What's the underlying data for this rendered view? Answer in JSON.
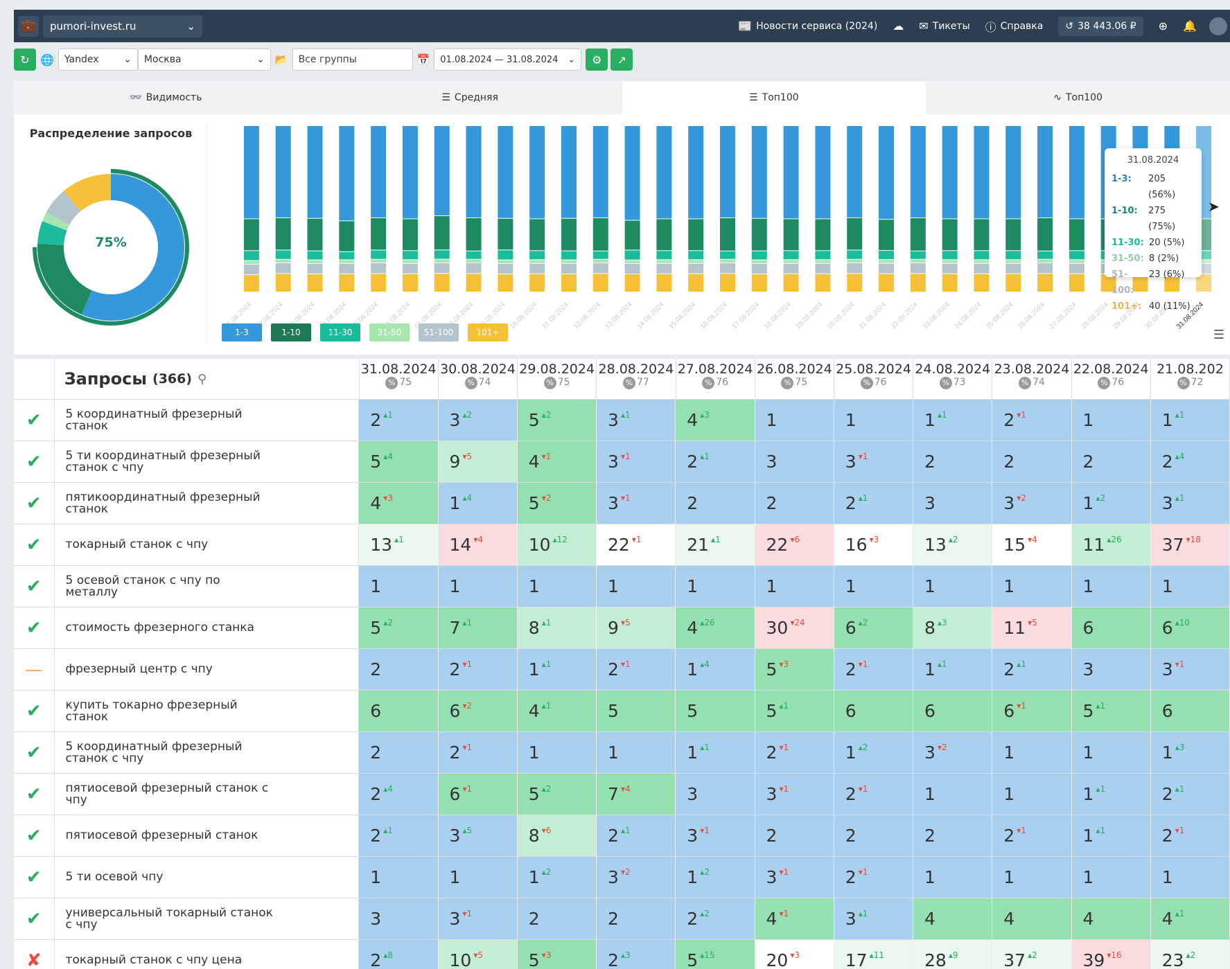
{
  "topbar": {
    "project": "pumori-invest.ru",
    "news": "Новости сервиса (2024)",
    "tickets": "Тикеты",
    "help": "Справка",
    "balance": "38 443.06 ₽"
  },
  "toolbar": {
    "engine": "Yandex",
    "region": "Москва",
    "groups_placeholder": "Все группы",
    "period": "01.08.2024 — 31.08.2024"
  },
  "tabs": [
    "Видимость",
    "Средняя",
    "Топ100",
    "Топ100"
  ],
  "chart": {
    "donut_title": "Распределение запросов",
    "donut_value": "75%",
    "legend": [
      "1-3",
      "1-10",
      "11-30",
      "31-50",
      "51-100",
      "101+"
    ],
    "colors": {
      "1-3": "#3498db",
      "1-10": "#1e8a60",
      "11-30": "#1abc9c",
      "31-50": "#a8e6b0",
      "51-100": "#b4c4cc",
      "101+": "#f7c137"
    },
    "tooltip": {
      "date": "31.08.2024",
      "rows": [
        {
          "label": "1-3:",
          "value": "205 (56%)",
          "color": "#2980b9"
        },
        {
          "label": "1-10:",
          "value": "275 (75%)",
          "color": "#1e8a60"
        },
        {
          "label": "11-30:",
          "value": "20 (5%)",
          "color": "#1abc9c"
        },
        {
          "label": "31-50:",
          "value": "8 (2%)",
          "color": "#8fd19e"
        },
        {
          "label": "51-100:",
          "value": "23 (6%)",
          "color": "#aab7bf"
        },
        {
          "label": "101+:",
          "value": "40 (11%)",
          "color": "#f0b14d"
        }
      ]
    }
  },
  "chart_data": {
    "type": "bar",
    "categories": [
      "01.08.2024",
      "02.08.2024",
      "03.08.2024",
      "04.08.2024",
      "05.08.2024",
      "06.08.2024",
      "07.08.2024",
      "08.08.2024",
      "09.08.2024",
      "10.08.2024",
      "11.08.2024",
      "12.08.2024",
      "13.08.2024",
      "14.08.2024",
      "15.08.2024",
      "16.08.2024",
      "17.08.2024",
      "18.08.2024",
      "19.08.2024",
      "20.08.2024",
      "21.08.2024",
      "22.08.2024",
      "23.08.2024",
      "24.08.2024",
      "25.08.2024",
      "26.08.2024",
      "27.08.2024",
      "28.08.2024",
      "29.08.2024",
      "30.08.2024",
      "31.08.2024"
    ],
    "stacked": true,
    "series": [
      {
        "name": "1-3",
        "values": [
          205,
          200,
          205,
          210,
          200,
          205,
          195,
          200,
          205,
          205,
          205,
          200,
          210,
          205,
          205,
          200,
          205,
          205,
          205,
          200,
          205,
          200,
          205,
          205,
          205,
          200,
          205,
          205,
          205,
          205,
          205
        ]
      },
      {
        "name": "1-10",
        "values": [
          70,
          70,
          72,
          68,
          70,
          70,
          74,
          72,
          70,
          70,
          72,
          72,
          66,
          70,
          70,
          72,
          72,
          70,
          70,
          70,
          68,
          72,
          70,
          70,
          70,
          72,
          70,
          70,
          70,
          70,
          70
        ]
      },
      {
        "name": "11-30",
        "values": [
          22,
          20,
          20,
          18,
          20,
          20,
          20,
          18,
          22,
          20,
          20,
          18,
          22,
          20,
          20,
          18,
          20,
          20,
          20,
          20,
          20,
          18,
          20,
          20,
          20,
          18,
          20,
          20,
          20,
          20,
          20
        ]
      },
      {
        "name": "31-50",
        "values": [
          8,
          8,
          8,
          8,
          8,
          8,
          8,
          8,
          8,
          8,
          8,
          8,
          8,
          8,
          8,
          8,
          8,
          8,
          8,
          8,
          8,
          8,
          8,
          8,
          8,
          8,
          8,
          8,
          8,
          8,
          8
        ]
      },
      {
        "name": "51-100",
        "values": [
          23,
          23,
          23,
          23,
          23,
          23,
          23,
          23,
          23,
          23,
          23,
          23,
          23,
          23,
          23,
          23,
          23,
          23,
          23,
          23,
          23,
          23,
          23,
          23,
          23,
          23,
          23,
          23,
          23,
          23,
          23
        ]
      },
      {
        "name": "101+",
        "values": [
          38,
          40,
          40,
          40,
          40,
          40,
          40,
          40,
          40,
          40,
          40,
          40,
          40,
          40,
          40,
          40,
          40,
          40,
          40,
          40,
          40,
          40,
          40,
          40,
          40,
          40,
          40,
          40,
          40,
          40,
          40
        ]
      }
    ],
    "donut": [
      {
        "name": "1-3",
        "value": 56
      },
      {
        "name": "1-10",
        "value": 19
      },
      {
        "name": "11-30",
        "value": 5
      },
      {
        "name": "31-50",
        "value": 2
      },
      {
        "name": "51-100",
        "value": 6
      },
      {
        "name": "101+",
        "value": 11
      }
    ]
  },
  "table": {
    "title": "Запросы",
    "count": "(366)",
    "dates": [
      {
        "d": "31.08.2024",
        "p": "75"
      },
      {
        "d": "30.08.2024",
        "p": "74"
      },
      {
        "d": "29.08.2024",
        "p": "75"
      },
      {
        "d": "28.08.2024",
        "p": "77"
      },
      {
        "d": "27.08.2024",
        "p": "76"
      },
      {
        "d": "26.08.2024",
        "p": "75"
      },
      {
        "d": "25.08.2024",
        "p": "76"
      },
      {
        "d": "24.08.2024",
        "p": "73"
      },
      {
        "d": "23.08.2024",
        "p": "74"
      },
      {
        "d": "22.08.2024",
        "p": "76"
      },
      {
        "d": "21.08.202",
        "p": "72"
      }
    ],
    "rows": [
      {
        "status": "ok",
        "q": "5 координатный фрезерный станок",
        "cells": [
          [
            "2",
            "+1",
            "b"
          ],
          [
            "3",
            "+2",
            "b"
          ],
          [
            "5",
            "+2",
            "g"
          ],
          [
            "3",
            "+1",
            "b"
          ],
          [
            "4",
            "+3",
            "g"
          ],
          [
            "1",
            "",
            "b"
          ],
          [
            "1",
            "",
            "b"
          ],
          [
            "1",
            "+1",
            "b"
          ],
          [
            "2",
            "-1",
            "b"
          ],
          [
            "1",
            "",
            "b"
          ],
          [
            "1",
            "+1",
            "b"
          ]
        ]
      },
      {
        "status": "ok",
        "q": "5 ти координатный фрезерный станок с чпу",
        "cells": [
          [
            "5",
            "+4",
            "g"
          ],
          [
            "9",
            "-5",
            "lg"
          ],
          [
            "4",
            "-1",
            "g"
          ],
          [
            "3",
            "-1",
            "b"
          ],
          [
            "2",
            "+1",
            "b"
          ],
          [
            "3",
            "",
            "b"
          ],
          [
            "3",
            "-1",
            "b"
          ],
          [
            "2",
            "",
            "b"
          ],
          [
            "2",
            "",
            "b"
          ],
          [
            "2",
            "",
            "b"
          ],
          [
            "2",
            "+4",
            "b"
          ]
        ]
      },
      {
        "status": "ok",
        "q": "пятикоординатный фрезерный станок",
        "cells": [
          [
            "4",
            "-3",
            "g"
          ],
          [
            "1",
            "+4",
            "b"
          ],
          [
            "5",
            "-2",
            "g"
          ],
          [
            "3",
            "-1",
            "b"
          ],
          [
            "2",
            "",
            "b"
          ],
          [
            "2",
            "",
            "b"
          ],
          [
            "2",
            "+1",
            "b"
          ],
          [
            "3",
            "",
            "b"
          ],
          [
            "3",
            "-2",
            "b"
          ],
          [
            "1",
            "+2",
            "b"
          ],
          [
            "3",
            "+1",
            "b"
          ]
        ]
      },
      {
        "status": "ok",
        "q": "токарный станок с чпу",
        "cells": [
          [
            "13",
            "+1",
            "v"
          ],
          [
            "14",
            "-4",
            "p"
          ],
          [
            "10",
            "+12",
            "lg"
          ],
          [
            "22",
            "-1",
            "w"
          ],
          [
            "21",
            "+1",
            "v"
          ],
          [
            "22",
            "-6",
            "p"
          ],
          [
            "16",
            "-3",
            "w"
          ],
          [
            "13",
            "+2",
            "v"
          ],
          [
            "15",
            "-4",
            "w"
          ],
          [
            "11",
            "+26",
            "lg"
          ],
          [
            "37",
            "-18",
            "p"
          ]
        ]
      },
      {
        "status": "ok",
        "q": "5 осевой станок с чпу по металлу",
        "cells": [
          [
            "1",
            "",
            "b"
          ],
          [
            "1",
            "",
            "b"
          ],
          [
            "1",
            "",
            "b"
          ],
          [
            "1",
            "",
            "b"
          ],
          [
            "1",
            "",
            "b"
          ],
          [
            "1",
            "",
            "b"
          ],
          [
            "1",
            "",
            "b"
          ],
          [
            "1",
            "",
            "b"
          ],
          [
            "1",
            "",
            "b"
          ],
          [
            "1",
            "",
            "b"
          ],
          [
            "1",
            "",
            "b"
          ]
        ]
      },
      {
        "status": "ok",
        "q": "стоимость фрезерного станка",
        "cells": [
          [
            "5",
            "+2",
            "g"
          ],
          [
            "7",
            "+1",
            "g"
          ],
          [
            "8",
            "+1",
            "lg"
          ],
          [
            "9",
            "-5",
            "lg"
          ],
          [
            "4",
            "+26",
            "g"
          ],
          [
            "30",
            "-24",
            "p"
          ],
          [
            "6",
            "+2",
            "g"
          ],
          [
            "8",
            "+3",
            "lg"
          ],
          [
            "11",
            "-5",
            "p"
          ],
          [
            "6",
            "",
            "g"
          ],
          [
            "6",
            "+10",
            "g"
          ]
        ]
      },
      {
        "status": "mid",
        "q": "фрезерный центр с чпу",
        "cells": [
          [
            "2",
            "",
            "b"
          ],
          [
            "2",
            "-1",
            "b"
          ],
          [
            "1",
            "+1",
            "b"
          ],
          [
            "2",
            "-1",
            "b"
          ],
          [
            "1",
            "+4",
            "b"
          ],
          [
            "5",
            "-3",
            "g"
          ],
          [
            "2",
            "-1",
            "b"
          ],
          [
            "1",
            "+1",
            "b"
          ],
          [
            "2",
            "+1",
            "b"
          ],
          [
            "3",
            "",
            "b"
          ],
          [
            "3",
            "-1",
            "b"
          ]
        ]
      },
      {
        "status": "ok",
        "q": "купить токарно фрезерный станок",
        "cells": [
          [
            "6",
            "",
            "g"
          ],
          [
            "6",
            "-2",
            "g"
          ],
          [
            "4",
            "+1",
            "g"
          ],
          [
            "5",
            "",
            "g"
          ],
          [
            "5",
            "",
            "g"
          ],
          [
            "5",
            "+1",
            "g"
          ],
          [
            "6",
            "",
            "g"
          ],
          [
            "6",
            "",
            "g"
          ],
          [
            "6",
            "-1",
            "g"
          ],
          [
            "5",
            "+1",
            "g"
          ],
          [
            "6",
            "",
            "g"
          ]
        ]
      },
      {
        "status": "ok",
        "q": "5 координатный фрезерный станок с чпу",
        "cells": [
          [
            "2",
            "",
            "b"
          ],
          [
            "2",
            "-1",
            "b"
          ],
          [
            "1",
            "",
            "b"
          ],
          [
            "1",
            "",
            "b"
          ],
          [
            "1",
            "+1",
            "b"
          ],
          [
            "2",
            "-1",
            "b"
          ],
          [
            "1",
            "+2",
            "b"
          ],
          [
            "3",
            "-2",
            "b"
          ],
          [
            "1",
            "",
            "b"
          ],
          [
            "1",
            "",
            "b"
          ],
          [
            "1",
            "+3",
            "b"
          ]
        ]
      },
      {
        "status": "ok",
        "q": "пятиосевой фрезерный станок с чпу",
        "cells": [
          [
            "2",
            "+4",
            "b"
          ],
          [
            "6",
            "-1",
            "g"
          ],
          [
            "5",
            "+2",
            "g"
          ],
          [
            "7",
            "-4",
            "g"
          ],
          [
            "3",
            "",
            "b"
          ],
          [
            "3",
            "-1",
            "b"
          ],
          [
            "2",
            "-1",
            "b"
          ],
          [
            "1",
            "",
            "b"
          ],
          [
            "1",
            "",
            "b"
          ],
          [
            "1",
            "+1",
            "b"
          ],
          [
            "2",
            "+1",
            "b"
          ]
        ]
      },
      {
        "status": "ok",
        "q": "пятиосевой фрезерный станок",
        "cells": [
          [
            "2",
            "+1",
            "b"
          ],
          [
            "3",
            "+5",
            "b"
          ],
          [
            "8",
            "-6",
            "lg"
          ],
          [
            "2",
            "+1",
            "b"
          ],
          [
            "3",
            "-1",
            "b"
          ],
          [
            "2",
            "",
            "b"
          ],
          [
            "2",
            "",
            "b"
          ],
          [
            "2",
            "",
            "b"
          ],
          [
            "2",
            "-1",
            "b"
          ],
          [
            "1",
            "+1",
            "b"
          ],
          [
            "2",
            "-1",
            "b"
          ]
        ]
      },
      {
        "status": "ok",
        "q": "5 ти осевой чпу",
        "cells": [
          [
            "1",
            "",
            "b"
          ],
          [
            "1",
            "",
            "b"
          ],
          [
            "1",
            "+2",
            "b"
          ],
          [
            "3",
            "-2",
            "b"
          ],
          [
            "1",
            "+2",
            "b"
          ],
          [
            "3",
            "-1",
            "b"
          ],
          [
            "2",
            "-1",
            "b"
          ],
          [
            "1",
            "",
            "b"
          ],
          [
            "1",
            "",
            "b"
          ],
          [
            "1",
            "",
            "b"
          ],
          [
            "1",
            "",
            "b"
          ]
        ]
      },
      {
        "status": "ok",
        "q": "универсальный токарный станок с чпу",
        "cells": [
          [
            "3",
            "",
            "b"
          ],
          [
            "3",
            "-1",
            "b"
          ],
          [
            "2",
            "",
            "b"
          ],
          [
            "2",
            "",
            "b"
          ],
          [
            "2",
            "+2",
            "b"
          ],
          [
            "4",
            "-1",
            "g"
          ],
          [
            "3",
            "+1",
            "b"
          ],
          [
            "4",
            "",
            "g"
          ],
          [
            "4",
            "",
            "g"
          ],
          [
            "4",
            "",
            "g"
          ],
          [
            "4",
            "+1",
            "g"
          ]
        ]
      },
      {
        "status": "no",
        "q": "токарный станок с чпу цена",
        "cells": [
          [
            "2",
            "+8",
            "b"
          ],
          [
            "10",
            "-5",
            "lg"
          ],
          [
            "5",
            "-3",
            "g"
          ],
          [
            "2",
            "+3",
            "b"
          ],
          [
            "5",
            "+15",
            "g"
          ],
          [
            "20",
            "-3",
            "w"
          ],
          [
            "17",
            "+11",
            "v"
          ],
          [
            "28",
            "+9",
            "v"
          ],
          [
            "37",
            "+2",
            "v"
          ],
          [
            "39",
            "-16",
            "p"
          ],
          [
            "23",
            "+2",
            "v"
          ]
        ]
      }
    ]
  }
}
